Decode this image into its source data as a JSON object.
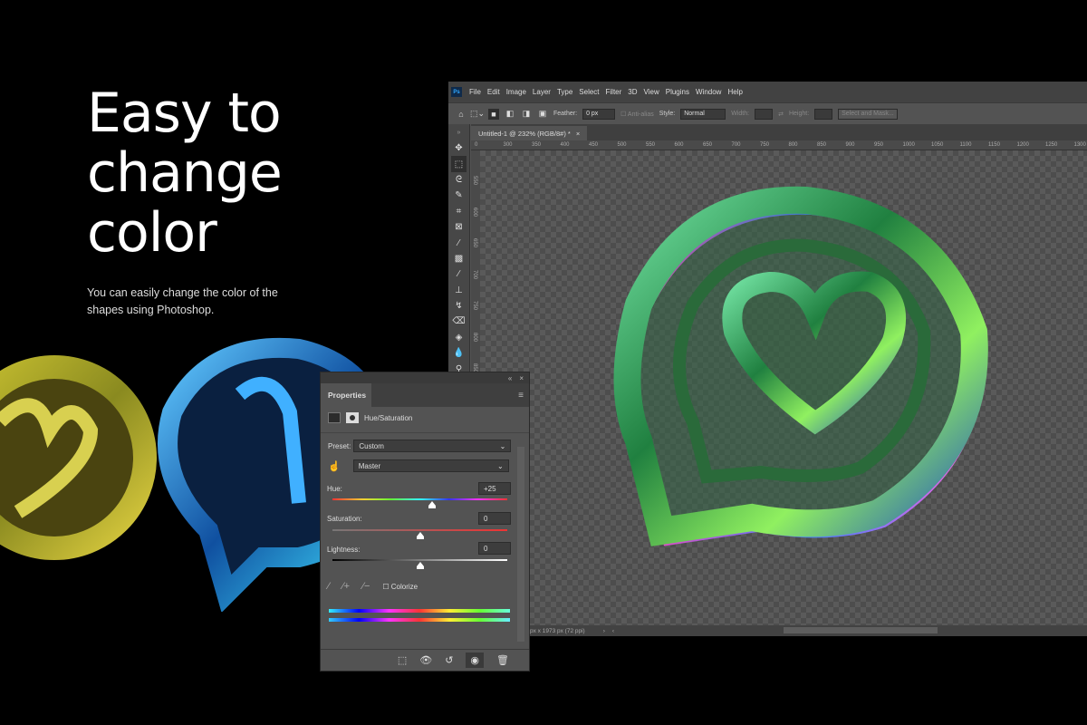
{
  "hero": {
    "title": "Easy to\nchange\ncolor",
    "subtitle": "You can easily change the color of the shapes using Photoshop."
  },
  "photoshop": {
    "logo": "Ps",
    "menu": [
      "File",
      "Edit",
      "Image",
      "Layer",
      "Type",
      "Select",
      "Filter",
      "3D",
      "View",
      "Plugins",
      "Window",
      "Help"
    ],
    "options": {
      "feather_label": "Feather:",
      "feather_value": "0 px",
      "antialias_label": "Anti-alias",
      "style_label": "Style:",
      "style_value": "Normal",
      "width_label": "Width:",
      "height_label": "Height:",
      "select_mask": "Select and Mask..."
    },
    "doc_tab": "Untitled-1 @ 232% (RGB/8#) *",
    "hruler": [
      "0",
      "300",
      "350",
      "400",
      "450",
      "500",
      "550",
      "600",
      "650",
      "700",
      "750",
      "800",
      "850",
      "900",
      "950",
      "1000",
      "1050",
      "1100",
      "1150",
      "1200",
      "1250",
      "1300"
    ],
    "vruler": [
      "550",
      "600",
      "650",
      "700",
      "750",
      "800",
      "850",
      "900"
    ],
    "status": "px x 1973 px (72 ppi)"
  },
  "properties": {
    "title": "Properties",
    "adjustment": "Hue/Saturation",
    "preset_label": "Preset:",
    "preset_value": "Custom",
    "channel": "Master",
    "hue_label": "Hue:",
    "hue_value": "+25",
    "hue": 25,
    "saturation_label": "Saturation:",
    "saturation_value": "0",
    "saturation": 0,
    "lightness_label": "Lightness:",
    "lightness_value": "0",
    "lightness": 0,
    "colorize_label": "Colorize"
  }
}
